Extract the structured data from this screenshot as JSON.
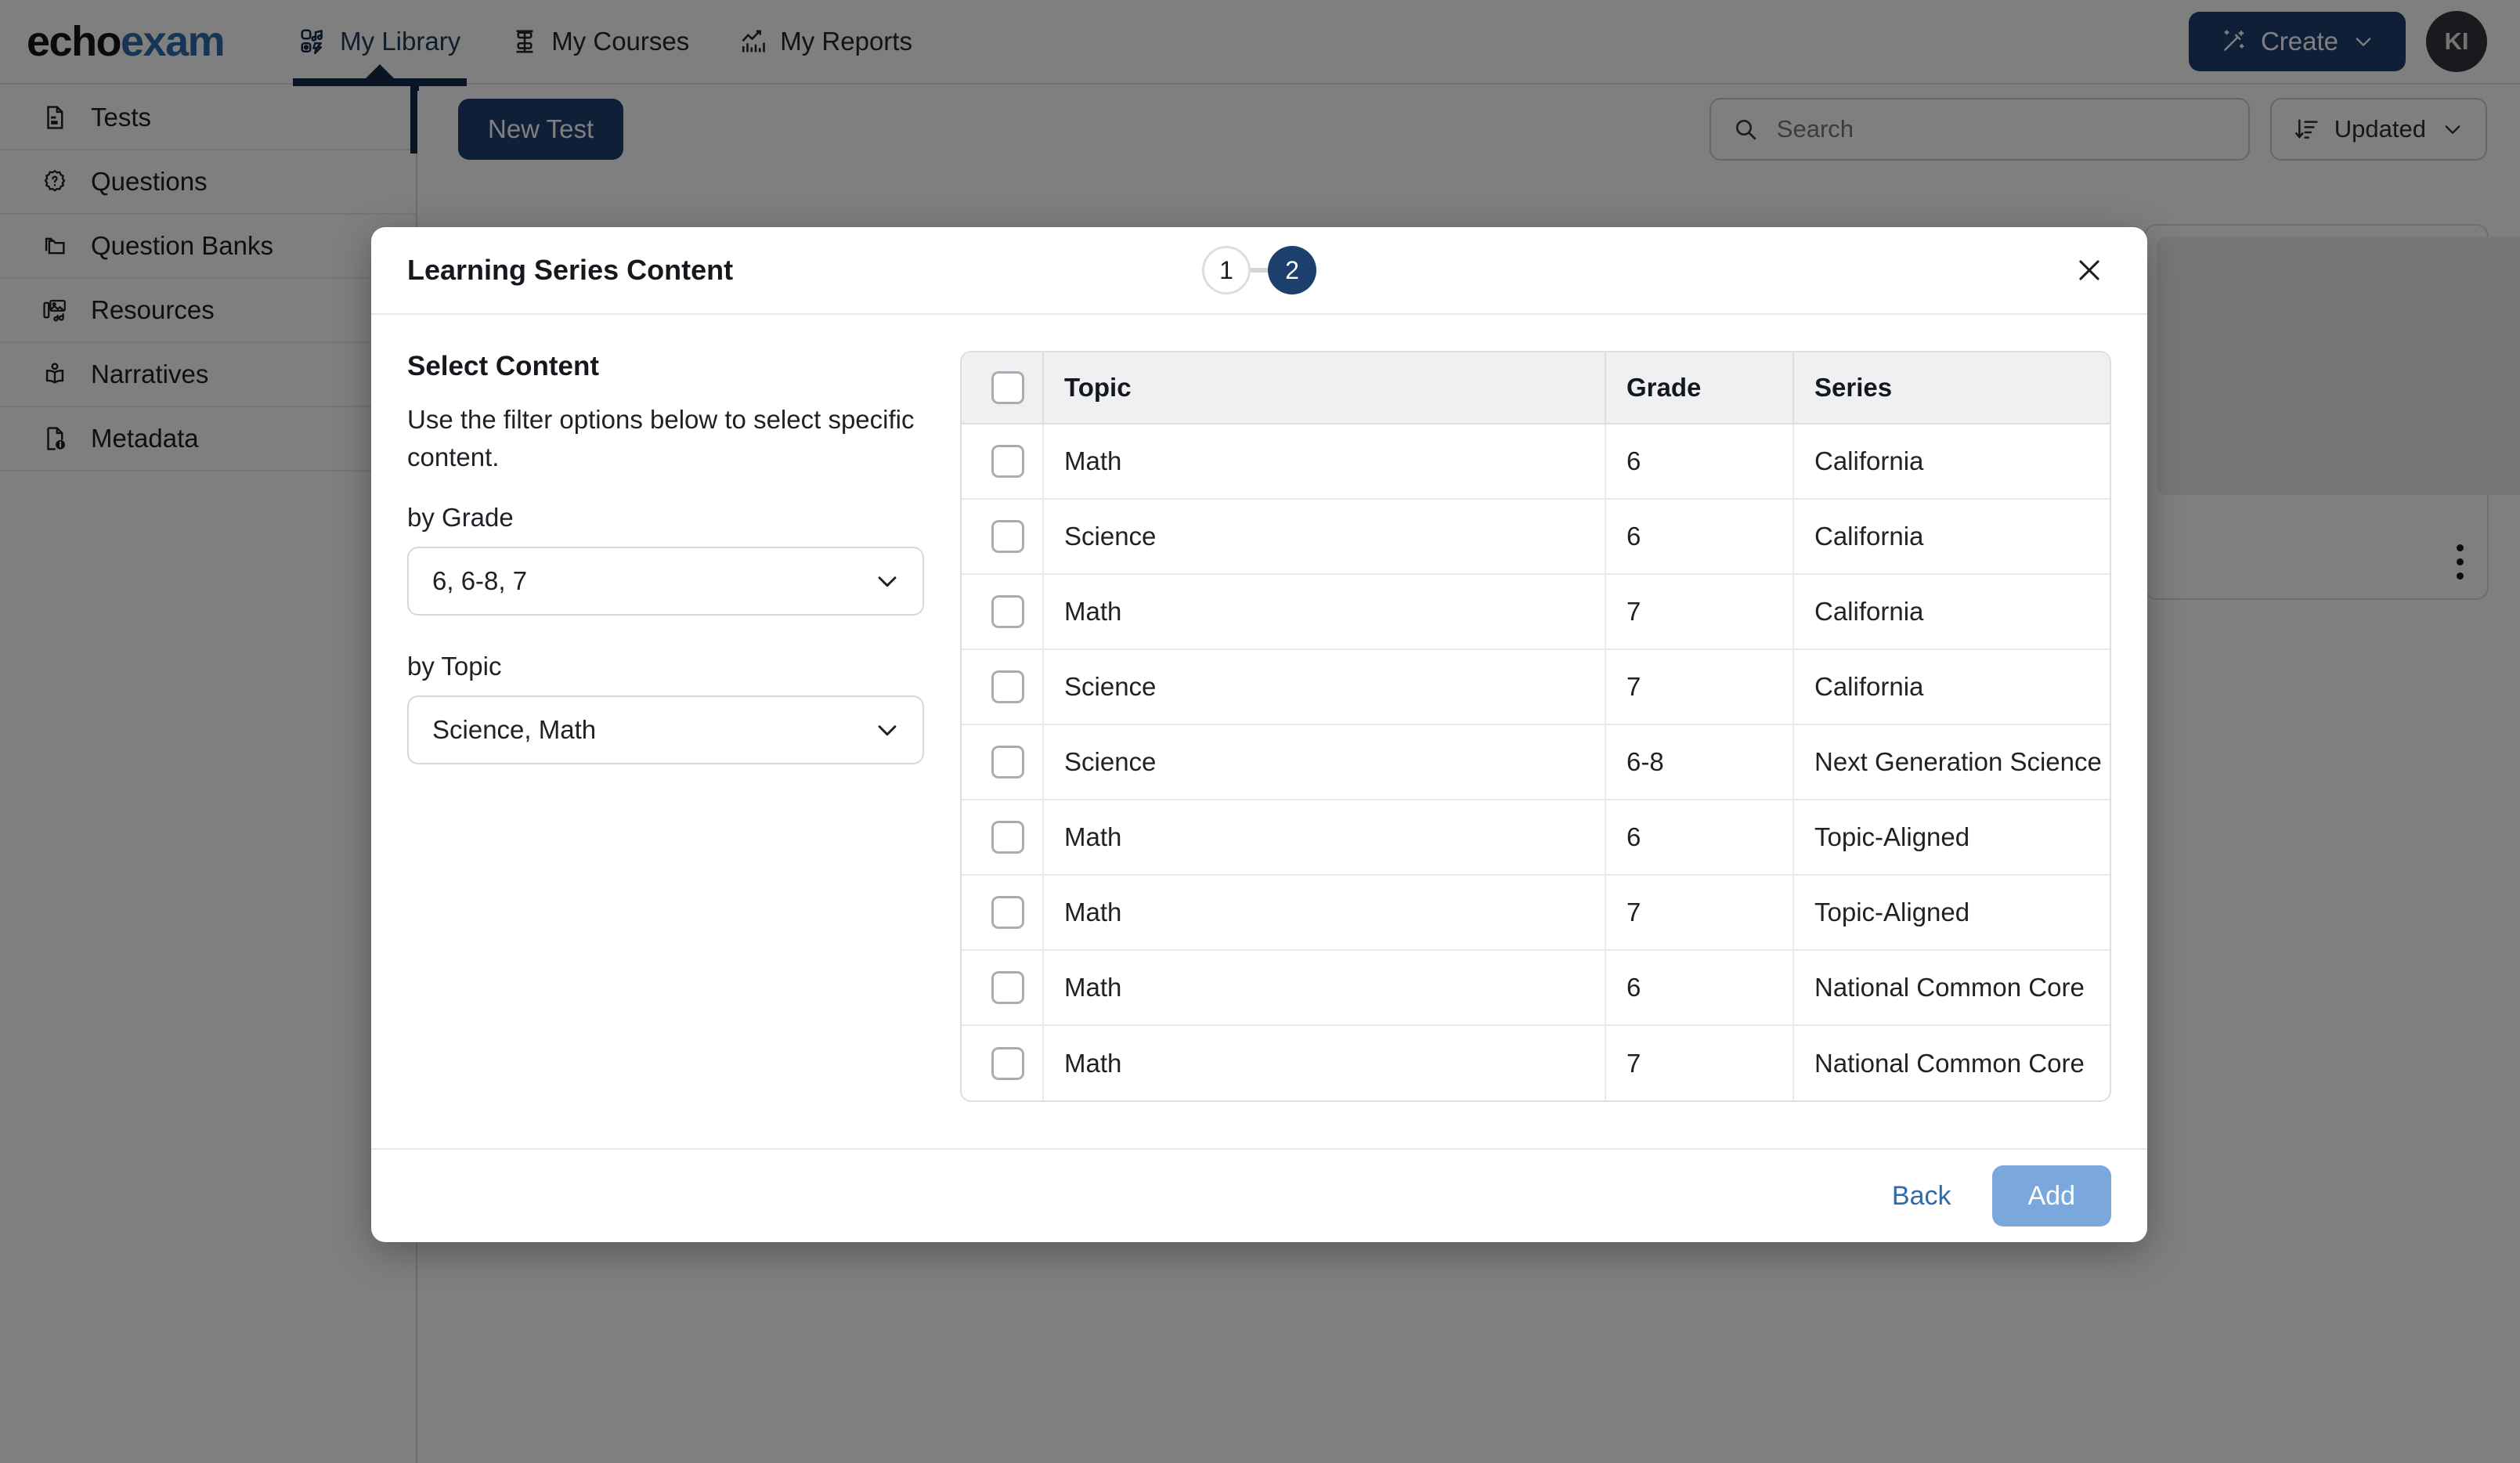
{
  "brand": {
    "part1": "echo",
    "part2": "exam"
  },
  "nav": {
    "tabs": [
      {
        "label": "My Library",
        "icon": "library-icon",
        "active": true
      },
      {
        "label": "My Courses",
        "icon": "courses-icon",
        "active": false
      },
      {
        "label": "My Reports",
        "icon": "reports-icon",
        "active": false
      }
    ],
    "create_label": "Create",
    "create_icon": "magic-wand-icon",
    "avatar_initials": "KI"
  },
  "sidebar": {
    "items": [
      {
        "label": "Tests",
        "icon": "document-icon"
      },
      {
        "label": "Questions",
        "icon": "question-badge-icon"
      },
      {
        "label": "Question Banks",
        "icon": "folders-icon"
      },
      {
        "label": "Resources",
        "icon": "media-icon"
      },
      {
        "label": "Narratives",
        "icon": "open-book-icon"
      },
      {
        "label": "Metadata",
        "icon": "document-info-icon"
      }
    ]
  },
  "toolbar": {
    "new_test_label": "New Test",
    "search_placeholder": "Search",
    "search_value": "",
    "search_icon": "search-icon",
    "sort_label": "Updated",
    "sort_icon": "sort-descending-icon",
    "sort_chevron": "chevron-down-icon"
  },
  "modal": {
    "title": "Learning Series Content",
    "close_icon": "close-icon",
    "steps": [
      {
        "number": "1",
        "active": false
      },
      {
        "number": "2",
        "active": true
      }
    ],
    "filters": {
      "heading": "Select Content",
      "description": "Use the filter options below to select specific content.",
      "grade_label": "by Grade",
      "grade_value": "6, 6-8, 7",
      "topic_label": "by Topic",
      "topic_value": "Science, Math",
      "chevron_icon": "chevron-down-icon"
    },
    "table": {
      "columns": [
        "Topic",
        "Grade",
        "Series"
      ],
      "rows": [
        {
          "topic": "Math",
          "grade": "6",
          "series": "California"
        },
        {
          "topic": "Science",
          "grade": "6",
          "series": "California"
        },
        {
          "topic": "Math",
          "grade": "7",
          "series": "California"
        },
        {
          "topic": "Science",
          "grade": "7",
          "series": "California"
        },
        {
          "topic": "Science",
          "grade": "6-8",
          "series": "Next Generation Science"
        },
        {
          "topic": "Math",
          "grade": "6",
          "series": "Topic-Aligned"
        },
        {
          "topic": "Math",
          "grade": "7",
          "series": "Topic-Aligned"
        },
        {
          "topic": "Math",
          "grade": "6",
          "series": "National Common Core"
        },
        {
          "topic": "Math",
          "grade": "7",
          "series": "National Common Core"
        }
      ]
    },
    "footer": {
      "back_label": "Back",
      "add_label": "Add"
    }
  },
  "colors": {
    "brand_navy": "#1c3f6e",
    "brand_blue": "#2f6bab",
    "accent_navy": "#12284a",
    "add_button": "#7aa8dd"
  }
}
